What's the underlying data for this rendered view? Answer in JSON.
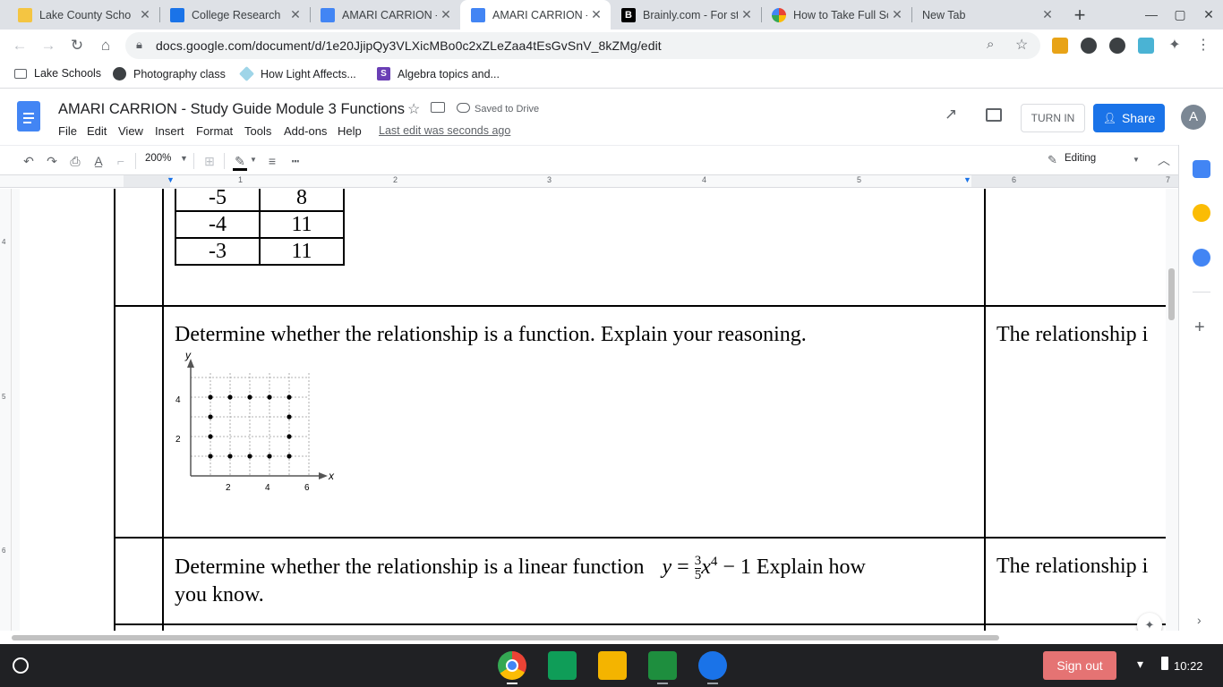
{
  "browser": {
    "tabs": [
      {
        "title": "Lake County Scho",
        "favicon": "school-icon",
        "active": false
      },
      {
        "title": "College Research",
        "favicon": "classroom-icon",
        "active": false
      },
      {
        "title": "AMARI CARRION - c",
        "favicon": "docs-icon",
        "active": false
      },
      {
        "title": "AMARI CARRION - S",
        "favicon": "docs-icon",
        "active": true
      },
      {
        "title": "Brainly.com - For st",
        "favicon": "brainly-icon",
        "active": false
      },
      {
        "title": "How to Take Full Sc",
        "favicon": "google-icon",
        "active": false
      },
      {
        "title": "New Tab",
        "favicon": "",
        "active": false
      }
    ],
    "new_tab": "+",
    "url": "docs.google.com/document/d/1e20JjipQy3VLXicMBo0c2xZLeZaa4tEsGvSnV_8kZMg/edit",
    "bookmarks": [
      "Lake Schools",
      "Photography class",
      "How Light Affects...",
      "Algebra topics and..."
    ]
  },
  "docs": {
    "title": "AMARI CARRION - Study Guide Module 3 Functions",
    "saved_status": "Saved to Drive",
    "menu": [
      "File",
      "Edit",
      "View",
      "Insert",
      "Format",
      "Tools",
      "Add-ons",
      "Help"
    ],
    "last_edit": "Last edit was seconds ago",
    "turn_in": "TURN IN",
    "share": "Share",
    "avatar_initial": "A",
    "zoom": "200%",
    "mode": "Editing",
    "ruler_labels": [
      "1",
      "2",
      "3",
      "4",
      "5",
      "6",
      "7"
    ],
    "vruler_labels": [
      "4",
      "5",
      "6"
    ]
  },
  "document": {
    "table_rows": [
      [
        "-5",
        "8"
      ],
      [
        "-4",
        "11"
      ],
      [
        "-3",
        "11"
      ]
    ],
    "question2": "Determine whether the relationship is a function.  Explain your reasoning.",
    "answer2": "The relationship i",
    "graph": {
      "y_label": "y",
      "x_label": "x",
      "y_ticks": [
        "4",
        "2"
      ],
      "x_ticks": [
        "2",
        "4",
        "6"
      ],
      "points": [
        [
          1,
          4
        ],
        [
          2,
          4
        ],
        [
          3,
          4
        ],
        [
          4,
          4
        ],
        [
          5,
          4
        ],
        [
          1,
          3
        ],
        [
          5,
          3
        ],
        [
          1,
          2
        ],
        [
          5,
          2
        ],
        [
          1,
          1
        ],
        [
          2,
          1
        ],
        [
          3,
          1
        ],
        [
          4,
          1
        ],
        [
          5,
          1
        ]
      ]
    },
    "question3_part1": "Determine whether the relationship is a linear function",
    "equation": {
      "lhs": "y",
      "eq": "=",
      "num": "3",
      "den": "5",
      "var": "x",
      "exp": "4",
      "tail": "− 1"
    },
    "question3_part2": "Explain how",
    "question3_line2": "you know.",
    "answer3": "The relationship i"
  },
  "shelf": {
    "sign_out": "Sign out",
    "time": "10:22"
  },
  "colors": {
    "accent": "#1a73e8",
    "tabstrip": "#dee1e6",
    "signout": "#e57373",
    "shelf": "#202124"
  }
}
